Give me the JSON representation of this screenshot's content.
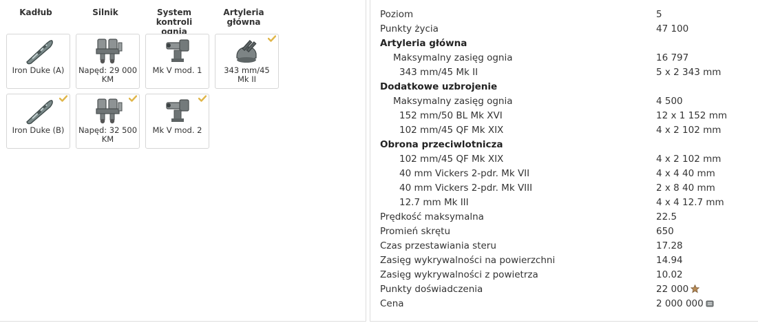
{
  "modules": {
    "headers": [
      {
        "line1": "Kadłub",
        "line2": ""
      },
      {
        "line1": "Silnik",
        "line2": ""
      },
      {
        "line1": "System",
        "line2": "kontroli ognia"
      },
      {
        "line1": "Artyleria",
        "line2": "główna"
      }
    ],
    "hull_a": {
      "line1": "Iron Duke (A)",
      "line2": "",
      "icon": "hull-icon",
      "checked": false
    },
    "hull_b": {
      "line1": "Iron Duke (B)",
      "line2": "",
      "icon": "hull-icon",
      "checked": true
    },
    "engine_a": {
      "line1": "Napęd: 29 000",
      "line2": "KM",
      "icon": "engine-icon",
      "checked": false
    },
    "engine_b": {
      "line1": "Napęd: 32 500",
      "line2": "KM",
      "icon": "engine-icon",
      "checked": true
    },
    "fc_a": {
      "line1": "Mk V mod. 1",
      "line2": "",
      "icon": "fire-control-icon",
      "checked": false
    },
    "fc_b": {
      "line1": "Mk V mod. 2",
      "line2": "",
      "icon": "fire-control-icon",
      "checked": true
    },
    "gun_a": {
      "line1": "343 mm/45",
      "line2": "Mk II",
      "icon": "main-battery-icon",
      "checked": true
    }
  },
  "stats": [
    {
      "label": "Poziom",
      "value": "5",
      "indent": 0,
      "heading": false
    },
    {
      "label": "Punkty życia",
      "value": "47 100",
      "indent": 0,
      "heading": false
    },
    {
      "label": "Artyleria główna",
      "value": "",
      "indent": 0,
      "heading": true
    },
    {
      "label": "Maksymalny zasięg ognia",
      "value": "16 797",
      "indent": 1,
      "heading": false
    },
    {
      "label": "343 mm/45 Mk II",
      "value": "5 x 2 343 mm",
      "indent": 2,
      "heading": false
    },
    {
      "label": "Dodatkowe uzbrojenie",
      "value": "",
      "indent": 0,
      "heading": true
    },
    {
      "label": "Maksymalny zasięg ognia",
      "value": "4 500",
      "indent": 1,
      "heading": false
    },
    {
      "label": "152 mm/50 BL Mk XVI",
      "value": "12 x 1 152 mm",
      "indent": 2,
      "heading": false
    },
    {
      "label": "102 mm/45 QF Mk XIX",
      "value": "4 x 2 102 mm",
      "indent": 2,
      "heading": false
    },
    {
      "label": "Obrona przeciwlotnicza",
      "value": "",
      "indent": 0,
      "heading": true
    },
    {
      "label": "102 mm/45 QF Mk XIX",
      "value": "4 x 2 102 mm",
      "indent": 2,
      "heading": false
    },
    {
      "label": "40 mm Vickers 2-pdr. Mk VII",
      "value": "4 x 4 40 mm",
      "indent": 2,
      "heading": false
    },
    {
      "label": "40 mm Vickers 2-pdr. Mk VIII",
      "value": "2 x 8 40 mm",
      "indent": 2,
      "heading": false
    },
    {
      "label": "12.7 mm Mk III",
      "value": "4 x 4 12.7 mm",
      "indent": 2,
      "heading": false
    },
    {
      "label": "Prędkość maksymalna",
      "value": "22.5",
      "indent": 0,
      "heading": false
    },
    {
      "label": "Promień skrętu",
      "value": "650",
      "indent": 0,
      "heading": false
    },
    {
      "label": "Czas przestawiania steru",
      "value": "17.28",
      "indent": 0,
      "heading": false
    },
    {
      "label": "Zasięg wykrywalności na powierzchni",
      "value": "14.94",
      "indent": 0,
      "heading": false
    },
    {
      "label": "Zasięg wykrywalności z powietrza",
      "value": "10.02",
      "indent": 0,
      "heading": false
    },
    {
      "label": "Punkty doświadczenia",
      "value": "22 000",
      "indent": 0,
      "heading": false,
      "icon": "xp-star-icon"
    },
    {
      "label": "Cena",
      "value": "2 000 000",
      "indent": 0,
      "heading": false,
      "icon": "credits-icon"
    }
  ],
  "colors": {
    "check": "#e0b64a",
    "border": "#d6d6d6",
    "text": "#333333"
  }
}
